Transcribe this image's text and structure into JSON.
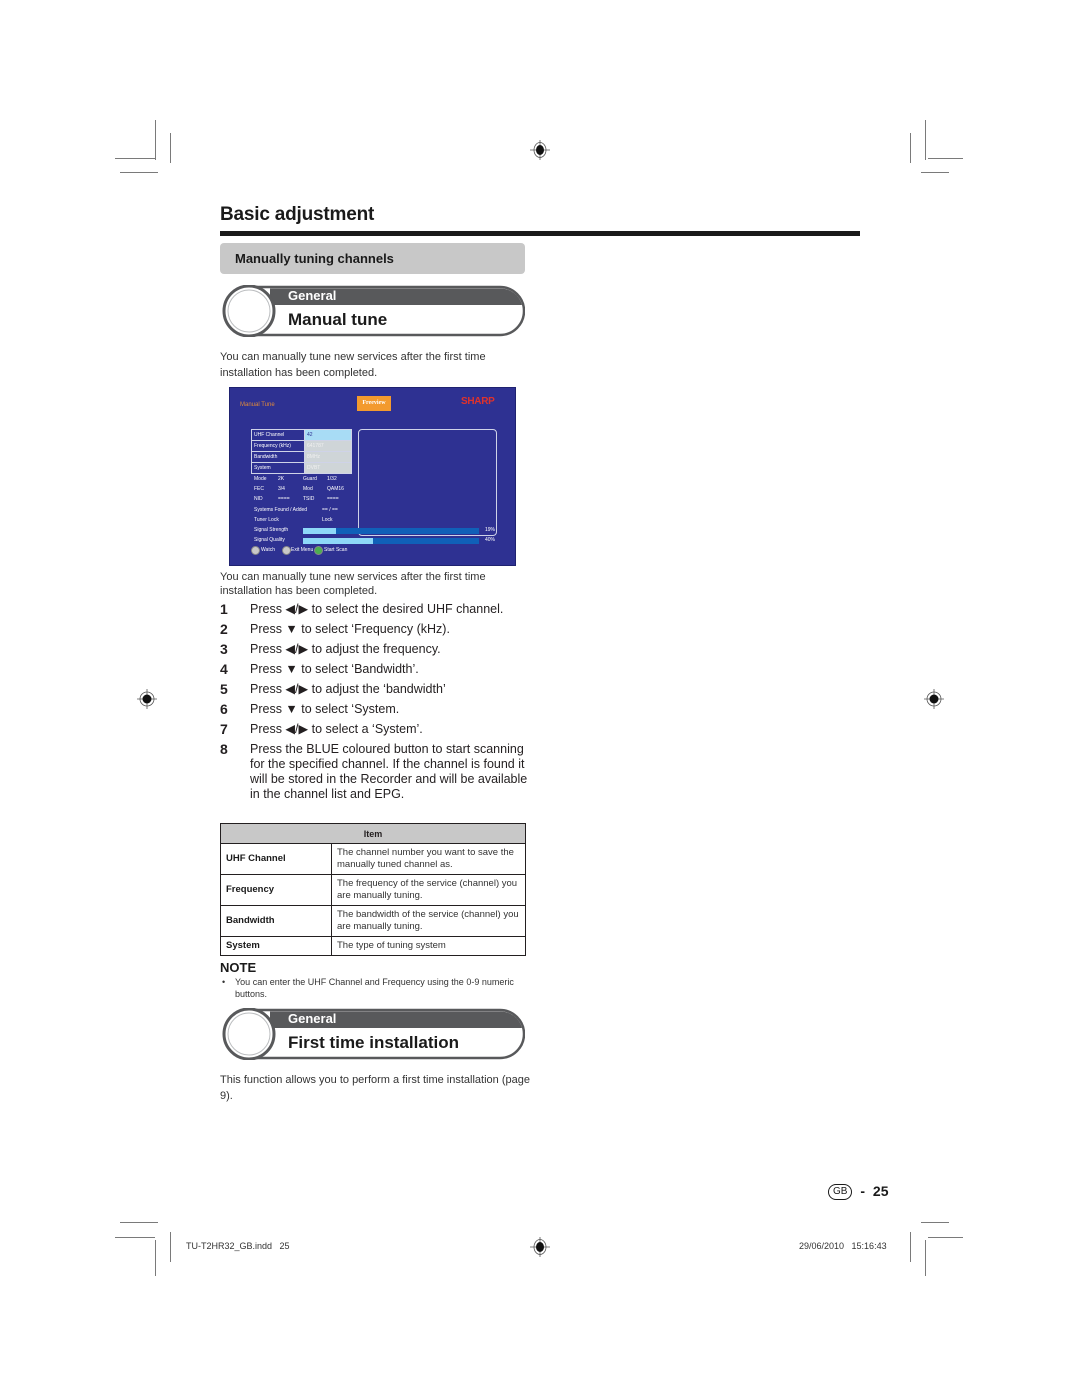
{
  "header": {
    "title": "Basic adjustment",
    "subheading": "Manually tuning channels"
  },
  "sections": [
    {
      "category": "General",
      "title": "Manual tune"
    },
    {
      "category": "General",
      "title": "First time installation"
    }
  ],
  "intro": "You can manually tune new services after the first time installation has been completed.",
  "tv_screen": {
    "title": "Manual Tune",
    "freeview_logo": "Freeview",
    "brand_logo": "SHARP",
    "fields": [
      {
        "label": "UHF Channel",
        "value": "42"
      },
      {
        "label": "Frequency (kHz)",
        "value": "641787"
      },
      {
        "label": "Bandwidth",
        "value": "8MHz"
      },
      {
        "label": "System",
        "value": "DVBT"
      }
    ],
    "info": {
      "mode_label": "Mode",
      "mode_value": "2K",
      "guard_label": "Guard",
      "guard_value": "1/32",
      "fec_label": "FEC",
      "fec_value": "3/4",
      "mod_label": "Mod",
      "mod_value": "QAM16",
      "nid_label": "NID",
      "nid_value": "====",
      "tsid_label": "TSID",
      "tsid_value": "====",
      "systems_label": "Systems Found / Added",
      "systems_value": "== / ==",
      "tuner_lock_label": "Tuner Lock",
      "tuner_lock_value": "Lock"
    },
    "signal_strength": {
      "label": "Signal Strength",
      "percent": 19,
      "text": "19%"
    },
    "signal_quality": {
      "label": "Signal Quality",
      "percent": 40,
      "text": "40%"
    },
    "buttons": [
      {
        "label": "Watch",
        "color": "#c8c8c8"
      },
      {
        "label": "Exit Menu",
        "color": "#c8c8c8"
      },
      {
        "label": "Start Scan",
        "color": "#4caf50"
      }
    ]
  },
  "caption": "You can manually tune new services after the first time installation has been completed.",
  "steps": [
    {
      "num": "1",
      "text": "Press ◀/▶ to select the desired UHF channel."
    },
    {
      "num": "2",
      "text": "Press ▼ to select ‘Frequency (kHz)."
    },
    {
      "num": "3",
      "text": "Press ◀/▶ to adjust the frequency."
    },
    {
      "num": "4",
      "text": "Press ▼ to select ‘Bandwidth’."
    },
    {
      "num": "5",
      "text": "Press ◀/▶ to adjust the ‘bandwidth’"
    },
    {
      "num": "6",
      "text": "Press ▼ to select ‘System."
    },
    {
      "num": "7",
      "text": "Press ◀/▶ to select a ‘System’."
    },
    {
      "num": "8",
      "text": "Press the BLUE coloured button to start scanning for the specified channel. If the channel is found it will be stored in the Recorder and will be available in the channel list and EPG."
    }
  ],
  "table": {
    "header": "Item",
    "rows": [
      {
        "item": "UHF Channel",
        "desc": "The channel number you want to save the manually tuned channel as."
      },
      {
        "item": "Frequency",
        "desc": "The frequency of the service (channel) you are manually tuning."
      },
      {
        "item": "Bandwidth",
        "desc": "The bandwidth of the service (channel) you are manually tuning."
      },
      {
        "item": "System",
        "desc": "The type of tuning system"
      }
    ]
  },
  "note": {
    "heading": "NOTE",
    "bullet": "You can enter the UHF Channel and Frequency using the 0-9 numeric buttons."
  },
  "first_time_text": "This function allows you to perform a first time installation (page 9).",
  "page": {
    "region_badge": "GB",
    "separator": "-",
    "number": "25"
  },
  "footer": {
    "file": "TU-T2HR32_GB.indd   25",
    "timestamp": "29/06/2010   15:16:43"
  }
}
